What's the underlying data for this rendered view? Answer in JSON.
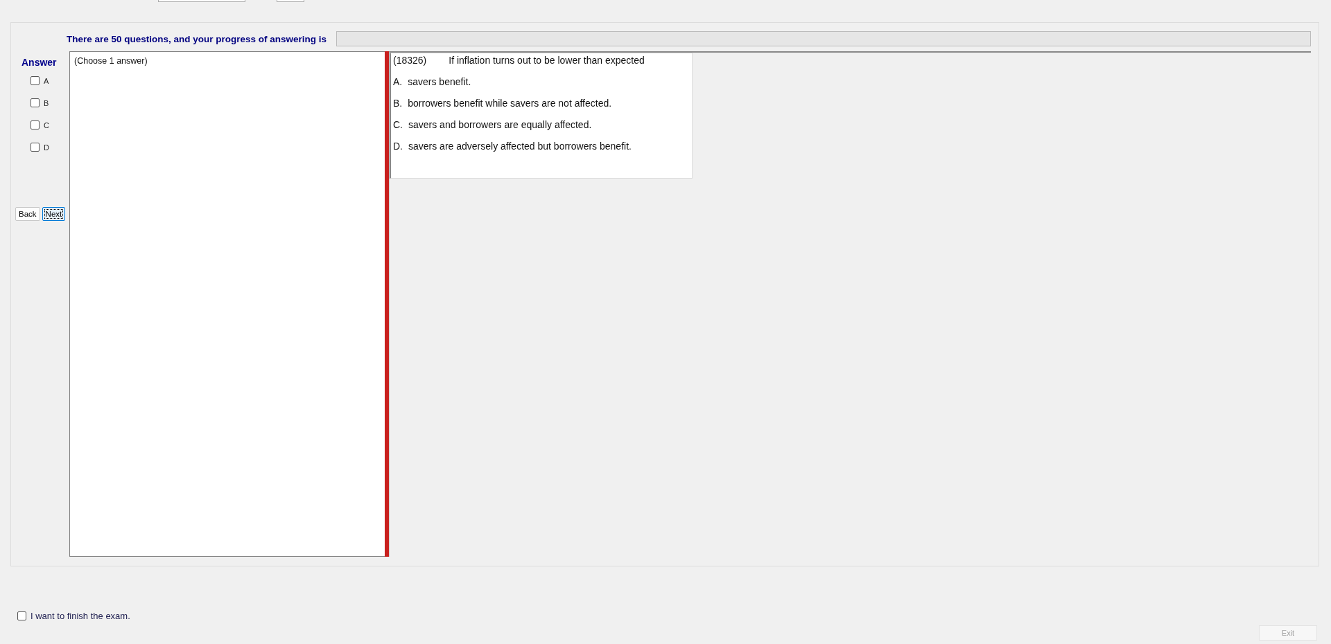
{
  "header": {
    "progress_label": "There are 50 questions, and your progress of answering is",
    "progress": {
      "level": 0
    }
  },
  "answer_panel": {
    "title": "Answer",
    "options": [
      {
        "label": "A",
        "checked": false
      },
      {
        "label": "B",
        "checked": false
      },
      {
        "label": "C",
        "checked": false
      },
      {
        "label": "D",
        "checked": false
      }
    ],
    "buttons": [
      {
        "label": "Back",
        "focused": false
      },
      {
        "label": "Next",
        "focused": true
      }
    ]
  },
  "answer_box": {
    "hint": "(Choose 1 answer)"
  },
  "question": {
    "number": "(18326)",
    "text": "If inflation turns out to be lower than expected",
    "choices": [
      {
        "letter": "A.",
        "text": "savers benefit."
      },
      {
        "letter": "B.",
        "text": "borrowers benefit while savers are not affected."
      },
      {
        "letter": "C.",
        "text": "savers and borrowers are equally affected."
      },
      {
        "letter": "D.",
        "text": "savers are adversely affected but borrowers benefit."
      }
    ]
  },
  "finish": {
    "label": "I want to finish the exam.",
    "checked": false
  },
  "exit_button": {
    "label": "Exit",
    "disabled": true
  }
}
